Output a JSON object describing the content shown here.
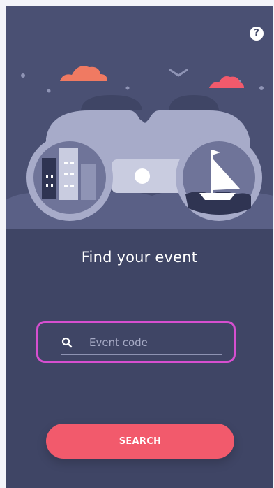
{
  "help": {
    "label": "?"
  },
  "main": {
    "title": "Find your event",
    "search": {
      "placeholder": "Event code",
      "value": ""
    },
    "search_button_label": "SEARCH"
  },
  "icons": {
    "help": "question-icon",
    "search": "search-icon",
    "illustration": "binoculars-illustration"
  },
  "colors": {
    "background": "#3f4565",
    "hero_background": "#4a5073",
    "accent": "#f25a6c",
    "focus_outline": "#d64fd0",
    "cloud": "#f07a62"
  }
}
